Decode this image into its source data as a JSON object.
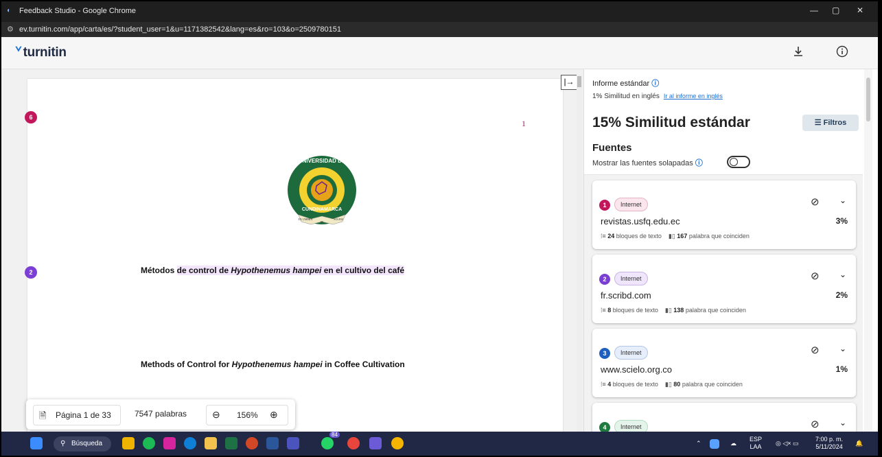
{
  "window": {
    "title": "Feedback Studio - Google Chrome",
    "url": "ev.turnitin.com/app/carta/es/?student_user=1&u=1171382542&lang=es&ro=103&o=2509780151",
    "minimize": "—",
    "restore": "▢",
    "close": "✕"
  },
  "header": {
    "logo": "turnitin",
    "download_icon": "download-icon",
    "info_icon": "info-icon"
  },
  "document": {
    "page_number": "1",
    "marker_6": "6",
    "marker_2": "2",
    "title_es_pre": "Métodos ",
    "title_es_hl1": "de control de ",
    "title_es_italic": "Hypothenemus hampei",
    "title_es_hl2": " en el cultivo del café",
    "title_en_pre": "Methods of Control for ",
    "title_en_italic": "Hypothenemus hampei",
    "title_en_post": " in Coffee Cultivation",
    "seal_top": "UNIVERSIDAD DE",
    "seal_bottom": "CUNDINAMARCA",
    "seal_motto_1": "EX UMBRA",
    "seal_motto_2": "IN",
    "seal_motto_3": "SOLEM"
  },
  "toolbar": {
    "page_label": "Página 1 de 33",
    "words": "7547 palabras",
    "zoom": "156%"
  },
  "panel": {
    "report_title": "Informe estándar",
    "english_similarity": "1% Similitud en inglés",
    "english_link": "Ir al informe en inglés",
    "similarity": "15% Similitud estándar",
    "filters_label": "Filtros",
    "sources_title": "Fuentes",
    "overlap_label": "Mostrar las fuentes solapadas",
    "sources": [
      {
        "num": "1",
        "color": "#c2185b",
        "type": "Internet",
        "name": "revistas.usfq.edu.ec",
        "pct": "3%",
        "blocks": "24",
        "blocks_label": "bloques de texto",
        "words": "167",
        "words_label": "palabra que coinciden"
      },
      {
        "num": "2",
        "color": "#7b3fd6",
        "type": "Internet",
        "name": "fr.scribd.com",
        "pct": "2%",
        "blocks": "8",
        "blocks_label": "bloques de texto",
        "words": "138",
        "words_label": "palabra que coinciden"
      },
      {
        "num": "3",
        "color": "#1f5fbf",
        "type": "Internet",
        "name": "www.scielo.org.co",
        "pct": "1%",
        "blocks": "4",
        "blocks_label": "bloques de texto",
        "words": "80",
        "words_label": "palabra que coinciden"
      },
      {
        "num": "4",
        "color": "#1e7a3e",
        "type": "Internet"
      }
    ]
  },
  "taskbar": {
    "search": "Búsqueda",
    "badge": "84",
    "lang_1": "ESP",
    "lang_2": "LAA",
    "time": "7:00 p. m.",
    "date": "5/11/2024"
  }
}
